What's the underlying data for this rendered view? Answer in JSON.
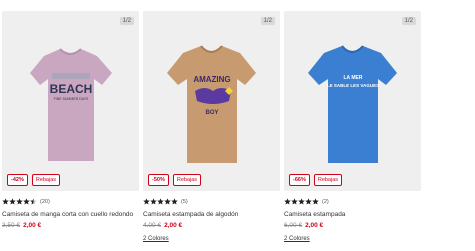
{
  "products": [
    {
      "page_indicator": "1/2",
      "discount": "-42%",
      "promo_label": "Rebajas",
      "rating": 4.5,
      "review_count": "(20)",
      "title": "Camiseta de manga corta con cuello redondo",
      "old_price": "3,50 €",
      "new_price": "2,00 €",
      "colors_link": "",
      "shirt_color": "#c9a7c1",
      "print_text_main": "BEACH",
      "print_text_sub": "FINE SUMMER DAYS"
    },
    {
      "page_indicator": "1/2",
      "discount": "-50%",
      "promo_label": "Rebajas",
      "rating": 5,
      "review_count": "(5)",
      "title": "Camiseta estampada de algodón",
      "old_price": "4,00 €",
      "new_price": "2,00 €",
      "colors_link": "2 Colores",
      "shirt_color": "#c79a6f",
      "print_text_main": "AMAZING",
      "print_text_sub": "BOY"
    },
    {
      "page_indicator": "1/2",
      "discount": "-66%",
      "promo_label": "Rebajas",
      "rating": 5,
      "review_count": "(2)",
      "title": "Camiseta estampada",
      "old_price": "6,00 €",
      "new_price": "2,00 €",
      "colors_link": "2 Colores",
      "shirt_color": "#3a7fd1",
      "print_text_main": "LA MER",
      "print_text_sub": "LE SABLE LES VAGUES"
    }
  ],
  "colors": {
    "accent": "#d0021b",
    "star": "#222222"
  }
}
